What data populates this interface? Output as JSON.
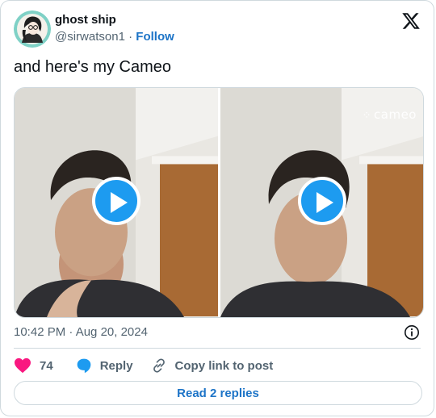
{
  "author": {
    "name": "ghost ship",
    "handle": "@sirwatson1",
    "separator": "·",
    "follow_label": "Follow"
  },
  "tweet": {
    "text": "and here's my Cameo",
    "timestamp": "10:42 PM · Aug 20, 2024"
  },
  "media": {
    "watermark": "cameo",
    "watermark_icon": "sparkle-dots-icon"
  },
  "actions": {
    "like_count": "74",
    "reply_label": "Reply",
    "copy_label": "Copy link to post"
  },
  "replies_button": "Read 2 replies",
  "colors": {
    "accent": "#1d9bf0",
    "link": "#1d74c7",
    "like": "#f91880",
    "muted": "#536471",
    "border": "#cfd9de"
  }
}
